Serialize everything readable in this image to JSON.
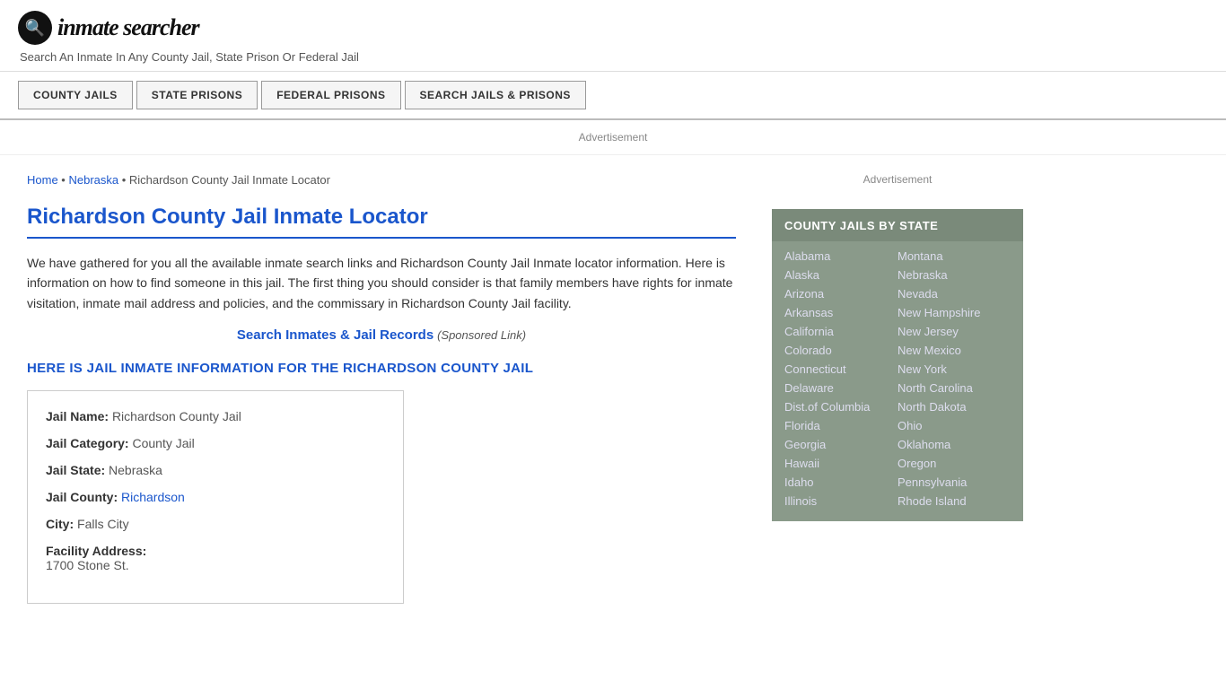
{
  "header": {
    "logo_text": "inmate searcher",
    "tagline": "Search An Inmate In Any County Jail, State Prison Or Federal Jail"
  },
  "nav": {
    "items": [
      {
        "label": "COUNTY JAILS",
        "id": "county-jails"
      },
      {
        "label": "STATE PRISONS",
        "id": "state-prisons"
      },
      {
        "label": "FEDERAL PRISONS",
        "id": "federal-prisons"
      },
      {
        "label": "SEARCH JAILS & PRISONS",
        "id": "search-jails"
      }
    ]
  },
  "ad": {
    "banner_label": "Advertisement"
  },
  "breadcrumb": {
    "home": "Home",
    "state": "Nebraska",
    "current": "Richardson County Jail Inmate Locator"
  },
  "page": {
    "title": "Richardson County Jail Inmate Locator",
    "description": "We have gathered for you all the available inmate search links and Richardson County Jail Inmate locator information. Here is information on how to find someone in this jail. The first thing you should consider is that family members have rights for inmate visitation, inmate mail address and policies, and the commissary in Richardson County Jail facility.",
    "search_link": "Search Inmates & Jail Records",
    "sponsored": "(Sponsored Link)",
    "jail_info_title": "HERE IS JAIL INMATE INFORMATION FOR THE RICHARDSON COUNTY JAIL"
  },
  "jail": {
    "name_label": "Jail Name:",
    "name_val": "Richardson County Jail",
    "category_label": "Jail Category:",
    "category_val": "County Jail",
    "state_label": "Jail State:",
    "state_val": "Nebraska",
    "county_label": "Jail County:",
    "county_val": "Richardson",
    "city_label": "City:",
    "city_val": "Falls City",
    "address_label": "Facility Address:",
    "address_val": "1700 Stone St."
  },
  "sidebar": {
    "ad_label": "Advertisement",
    "county_jails_header": "COUNTY JAILS BY STATE",
    "states_col1": [
      "Alabama",
      "Alaska",
      "Arizona",
      "Arkansas",
      "California",
      "Colorado",
      "Connecticut",
      "Delaware",
      "Dist.of Columbia",
      "Florida",
      "Georgia",
      "Hawaii",
      "Idaho",
      "Illinois"
    ],
    "states_col2": [
      "Montana",
      "Nebraska",
      "Nevada",
      "New Hampshire",
      "New Jersey",
      "New Mexico",
      "New York",
      "North Carolina",
      "North Dakota",
      "Ohio",
      "Oklahoma",
      "Oregon",
      "Pennsylvania",
      "Rhode Island"
    ]
  }
}
